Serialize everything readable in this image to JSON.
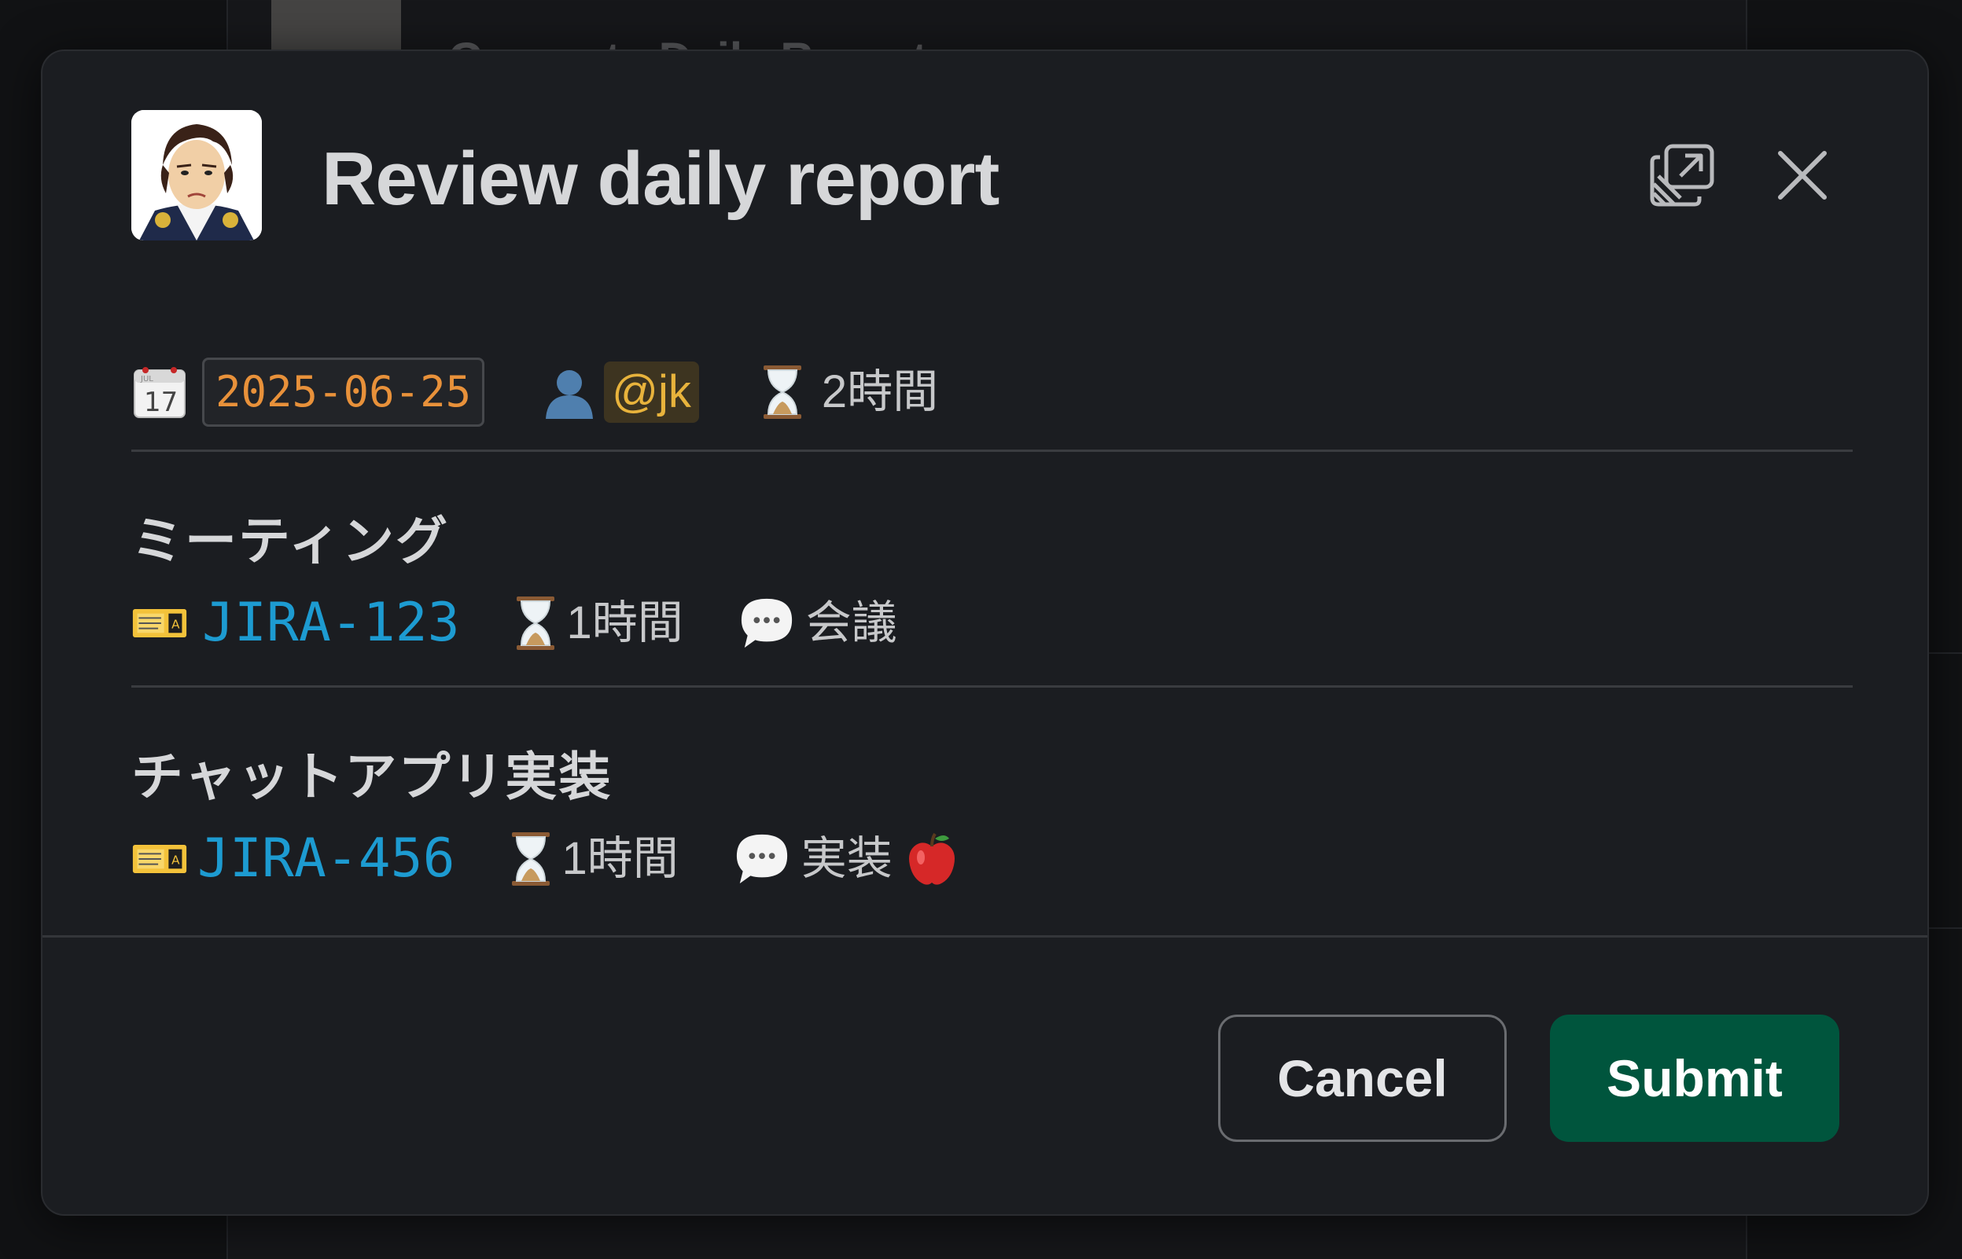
{
  "background": {
    "partial_item_title": "Generate Daily Report"
  },
  "modal": {
    "title": "Review daily report",
    "popout_icon": "popout-icon",
    "close_icon": "close-icon"
  },
  "report": {
    "date": "2025-06-25",
    "user": "@jk",
    "total_time": "2時間",
    "icons": {
      "date": "calendar-icon",
      "user": "bust-silhouette-icon",
      "time": "hourglass-icon"
    }
  },
  "tasks": [
    {
      "title": "ミーティング",
      "ticket": "JIRA-123",
      "time": "1時間",
      "comment": "会議",
      "comment_emoji": ""
    },
    {
      "title": "チャットアプリ実装",
      "ticket": "JIRA-456",
      "time": "1時間",
      "comment": "実装",
      "comment_emoji": "apple-icon"
    }
  ],
  "footer": {
    "cancel_label": "Cancel",
    "submit_label": "Submit"
  },
  "colors": {
    "modal_bg": "#1b1d21",
    "date_text": "#e8913a",
    "mention_text": "#e8b33c",
    "link": "#1d9bd1",
    "submit_bg": "#00553d"
  }
}
